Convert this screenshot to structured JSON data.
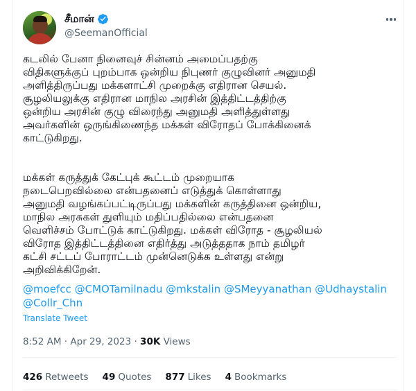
{
  "author": {
    "name": "சீமான்",
    "handle": "@SeemanOfficial"
  },
  "colors": {
    "link": "#1d9bf0",
    "verified": "#1d9bf0",
    "muted": "#536471"
  },
  "tweet": {
    "paragraph1": [
      "கடலில் பேனா நினைவுச் சின்னம் அமைப்பதற்கு",
      "விதிகளுக்குப் புறம்பாக ஒன்றிய நிபுணர் குழுவினர் அனுமதி",
      "அளித்திருப்பது மக்களாட்சி முறைக்கு எதிரான செயல்.",
      "சூழலியலுக்கு எதிரான மாநில அரசின் இத்திட்டத்திற்கு",
      "ஒன்றிய அரசின் குழு விரைந்து அனுமதி அளித்துள்ளது",
      "அவர்களின் ஒருங்கிணைந்த மக்கள் விரோதப் போக்கினைக்",
      "காட்டுகிறது."
    ],
    "paragraph2": [
      "மக்கள் கருத்துக் கேட்புக் கூட்டம் முறையாக",
      "நடைபெறவில்லை என்பதனைப் எடுத்துக் கொள்ளாது",
      "அனுமதி வழங்கப்பட்டிருப்பது மக்களின் கருத்தினை ஒன்றிய,",
      "மாநில அரசுகள் துளியும் மதிப்பதில்லை என்பதனை",
      "வெளிச்சம் போட்டுக் காட்டுகிறது. மக்கள் விரோத - சூழலியல்",
      "விரோத இத்திட்டத்தினை எதிர்த்து அடுத்ததாக நாம் தமிழர்",
      "கட்சி சட்டப் போராட்டம் முன்னெடுக்க உள்ளது என்று",
      "அறிவிக்கிறேன்."
    ],
    "mentions": [
      "@moefcc",
      "@CMOTamilnadu",
      "@mkstalin",
      "@SMeyyanathan",
      "@Udhaystalin",
      "@Collr_Chn"
    ],
    "translate_label": "Translate Tweet"
  },
  "meta": {
    "time": "8:52 AM",
    "date": "Apr 29, 2023",
    "views_count": "30K",
    "views_label": "Views"
  },
  "stats": {
    "retweets_count": "426",
    "retweets_label": "Retweets",
    "quotes_count": "49",
    "quotes_label": "Quotes",
    "likes_count": "877",
    "likes_label": "Likes",
    "bookmarks_count": "4",
    "bookmarks_label": "Bookmarks"
  }
}
